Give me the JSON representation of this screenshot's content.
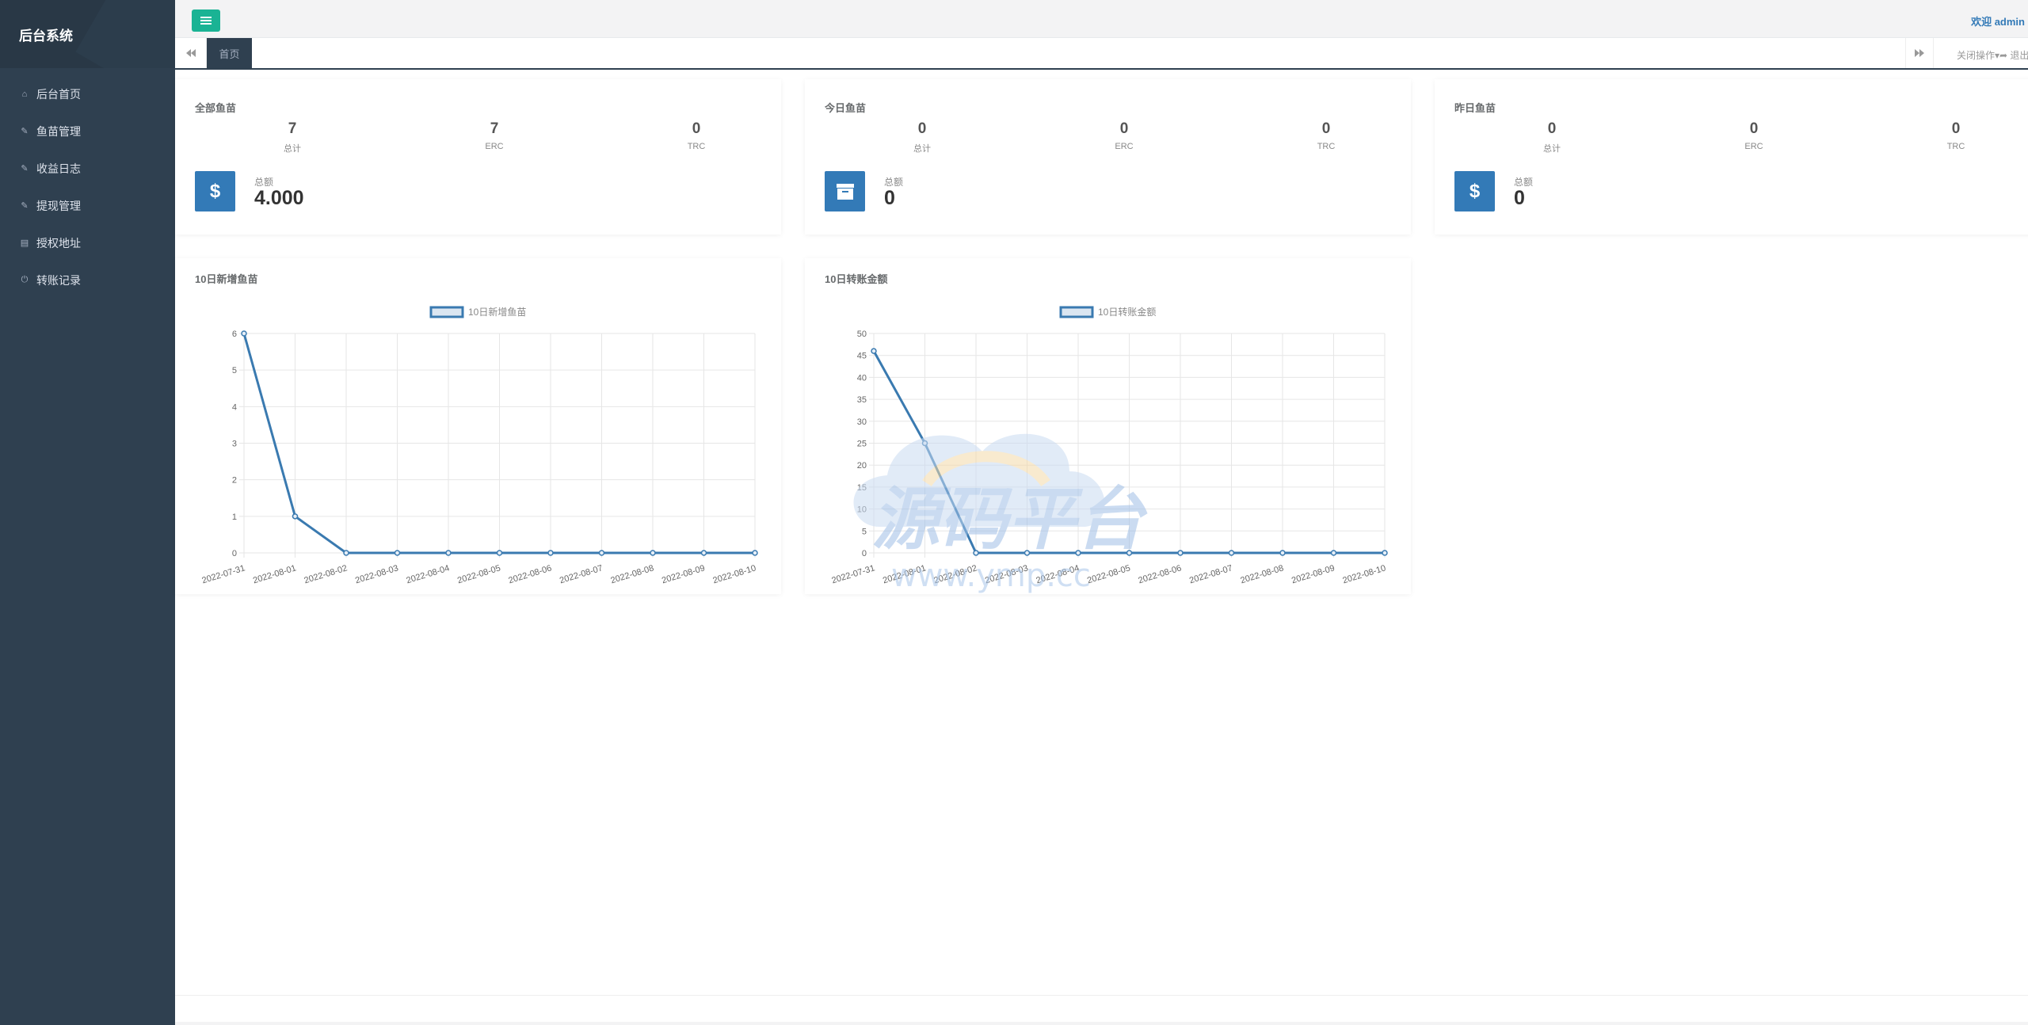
{
  "app": {
    "brand": "后台系统",
    "welcome": "欢迎 admin"
  },
  "sidebar": {
    "items": [
      {
        "label": "后台首页",
        "icon": "home-icon",
        "glyph": "⌂"
      },
      {
        "label": "鱼苗管理",
        "icon": "wrench-icon",
        "glyph": "✎"
      },
      {
        "label": "收益日志",
        "icon": "wrench-icon",
        "glyph": "✎"
      },
      {
        "label": "提现管理",
        "icon": "wrench-icon",
        "glyph": "✎"
      },
      {
        "label": "授权地址",
        "icon": "file-icon",
        "glyph": "▤"
      },
      {
        "label": "转账记录",
        "icon": "power-icon",
        "glyph": "⏻"
      }
    ]
  },
  "tabs": {
    "active": "首页",
    "close_ops": "关闭操作▾",
    "logout": "➦ 退出"
  },
  "cards": [
    {
      "title": "全部鱼苗",
      "stats": [
        {
          "value": "7",
          "label": "总计"
        },
        {
          "value": "7",
          "label": "ERC"
        },
        {
          "value": "0",
          "label": "TRC"
        }
      ],
      "icon": "dollar-icon",
      "icon_glyph": "$",
      "total_label": "总额",
      "total_value": "4.000"
    },
    {
      "title": "今日鱼苗",
      "stats": [
        {
          "value": "0",
          "label": "总计"
        },
        {
          "value": "0",
          "label": "ERC"
        },
        {
          "value": "0",
          "label": "TRC"
        }
      ],
      "icon": "archive-icon",
      "icon_glyph": "▣",
      "total_label": "总额",
      "total_value": "0"
    },
    {
      "title": "昨日鱼苗",
      "stats": [
        {
          "value": "0",
          "label": "总计"
        },
        {
          "value": "0",
          "label": "ERC"
        },
        {
          "value": "0",
          "label": "TRC"
        }
      ],
      "icon": "dollar-icon",
      "icon_glyph": "$",
      "total_label": "总额",
      "total_value": "0"
    }
  ],
  "chart_titles": [
    "10日新增鱼苗",
    "10日转账金额"
  ],
  "chart_data": [
    {
      "type": "line",
      "title": "10日新增鱼苗",
      "categories": [
        "2022-07-31",
        "2022-08-01",
        "2022-08-02",
        "2022-08-03",
        "2022-08-04",
        "2022-08-05",
        "2022-08-06",
        "2022-08-07",
        "2022-08-08",
        "2022-08-09",
        "2022-08-10"
      ],
      "series": [
        {
          "name": "10日新增鱼苗",
          "values": [
            6,
            1,
            0,
            0,
            0,
            0,
            0,
            0,
            0,
            0,
            0
          ]
        }
      ],
      "yticks": [
        0,
        1,
        2,
        3,
        4,
        5,
        6
      ],
      "ylim": [
        0,
        6
      ],
      "grid": true,
      "legend": "top",
      "color": "#3a7ab0"
    },
    {
      "type": "line",
      "title": "10日转账金额",
      "categories": [
        "2022-07-31",
        "2022-08-01",
        "2022-08-02",
        "2022-08-03",
        "2022-08-04",
        "2022-08-05",
        "2022-08-06",
        "2022-08-07",
        "2022-08-08",
        "2022-08-09",
        "2022-08-10"
      ],
      "series": [
        {
          "name": "10日转账金额",
          "values": [
            46,
            25,
            0,
            0,
            0,
            0,
            0,
            0,
            0,
            0,
            0
          ]
        }
      ],
      "yticks": [
        0,
        5,
        10,
        15,
        20,
        25,
        30,
        35,
        40,
        45,
        50
      ],
      "ylim": [
        0,
        50
      ],
      "grid": true,
      "legend": "top",
      "color": "#3a7ab0"
    }
  ],
  "watermark": {
    "text": "源码平台",
    "url": "www.ymp.cc"
  }
}
